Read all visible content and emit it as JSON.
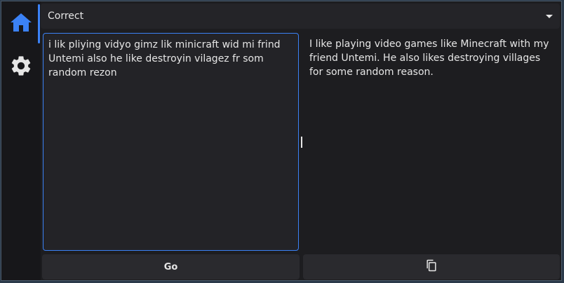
{
  "sidebar": {
    "items": [
      {
        "icon": "home-icon",
        "active": true
      },
      {
        "icon": "gear-icon",
        "active": false
      }
    ]
  },
  "mode": {
    "selected": "Correct"
  },
  "input": {
    "value": "i lik pliying vidyo gimz lik minicraft wid mi frind Untemi also he like destroyin vilagez fr som random rezon"
  },
  "output": {
    "value": "I like playing video games like Minecraft with my friend Untemi. He also likes destroying villages for some random reason."
  },
  "actions": {
    "go_label": "Go",
    "copy_icon": "copy-icon"
  },
  "colors": {
    "accent": "#3b82f6",
    "background": "#17171a",
    "panel": "#232327",
    "button": "#2a2a2e",
    "text": "#e6e6e6"
  }
}
